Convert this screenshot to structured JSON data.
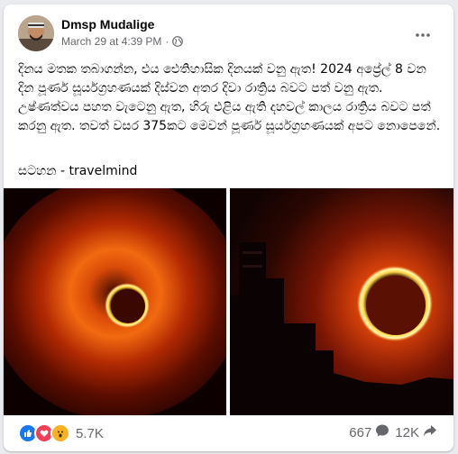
{
  "post": {
    "author": "Dmsp Mudalige",
    "timestamp": "March 29 at 4:39 PM",
    "separator": "·",
    "visibility_icon": "globe-icon",
    "menu_icon": "more-options-icon",
    "text": "දිනය මතක තබාගන්න, එය ඓතිහාසික දිනයක් වනු ඇත!  2024 අප්‍රේල් 8 වන දින පූර්ණ සූර්යග්‍රහණයක් දිස්වන අතර දිවා රාත්‍රිය බවට පත් වනු ඇත. උෂ්ණත්වය පහත වැටෙනු ඇත,  හිරු එළිය ඇති දහවල් කාලය රාත්‍රිය බවට පත් කරනු ඇත.  තවත් වසර 375කට මෙවන් පූර්ණ සූර්යග්‍රහණයක් අපට නොපෙනේ.",
    "source": "සටහන - travelmind"
  },
  "photos": [
    {
      "name": "eclipse-photo-1"
    },
    {
      "name": "eclipse-photo-2"
    }
  ],
  "stats": {
    "reaction_icons": [
      "like-icon",
      "love-icon",
      "wow-icon"
    ],
    "reactions_count": "5.7K",
    "comments_count": "667",
    "shares_count": "12K"
  },
  "colors": {
    "like": "#1877f2",
    "love": "#f33e58",
    "wow": "#f7b125",
    "secondary_text": "#65676b"
  }
}
